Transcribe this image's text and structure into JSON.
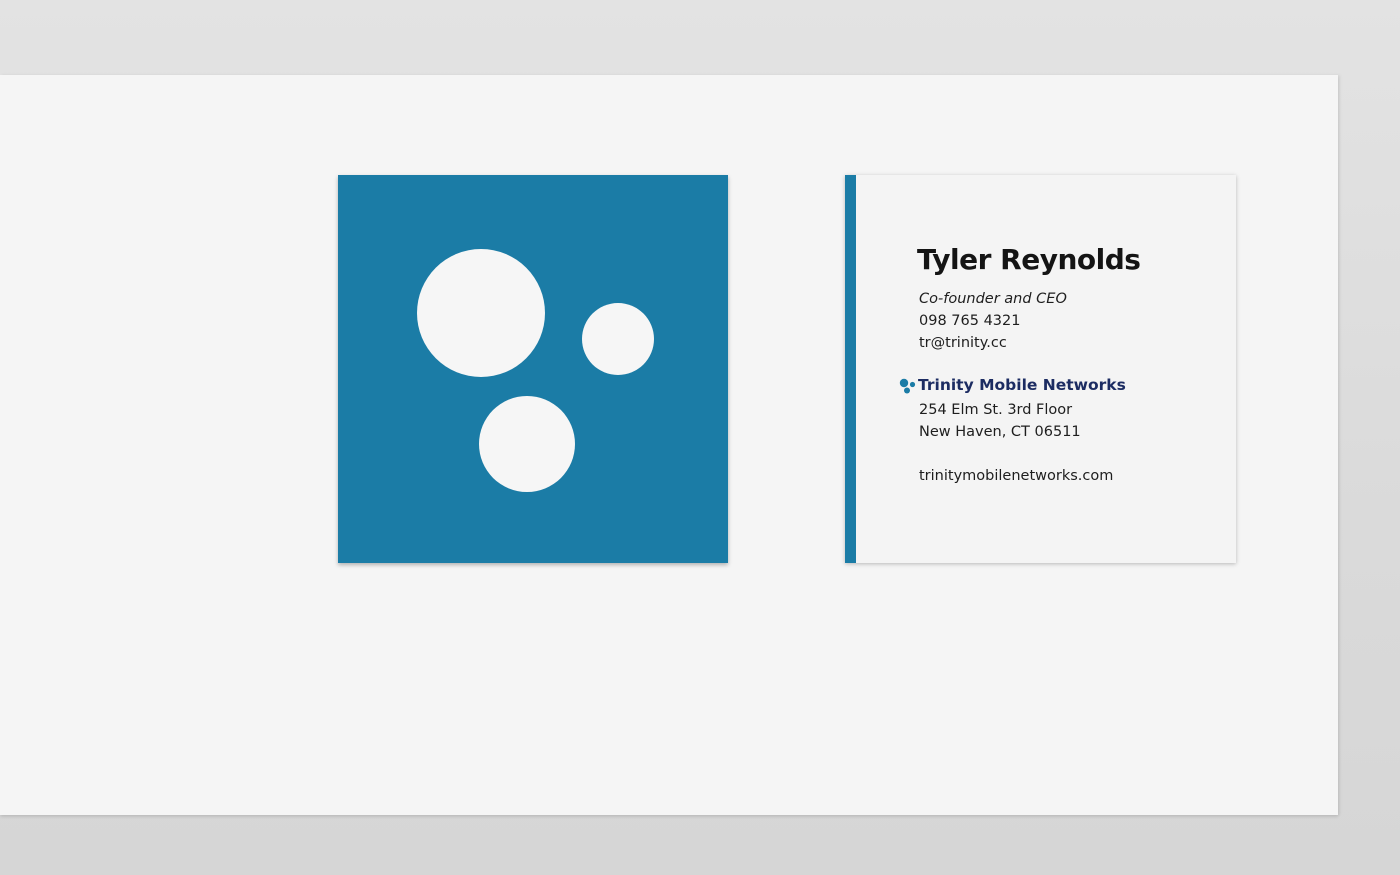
{
  "card": {
    "name": "Tyler Reynolds",
    "role": "Co-founder and CEO",
    "phone": "098 765 4321",
    "email": "tr@trinity.cc",
    "company": "Trinity Mobile Networks",
    "address_line1": "254 Elm St. 3rd Floor",
    "address_line2": "New Haven, CT 06511",
    "website": "trinitymobilenetworks.com"
  },
  "colors": {
    "brand_blue": "#1b7ca6",
    "company_navy": "#1c2c62",
    "paper": "#f5f5f5",
    "backdrop": "#dcdcdc"
  },
  "icons": {
    "front_logo": "three-circles-logo-icon",
    "company_mark": "three-dots-logo-icon"
  }
}
